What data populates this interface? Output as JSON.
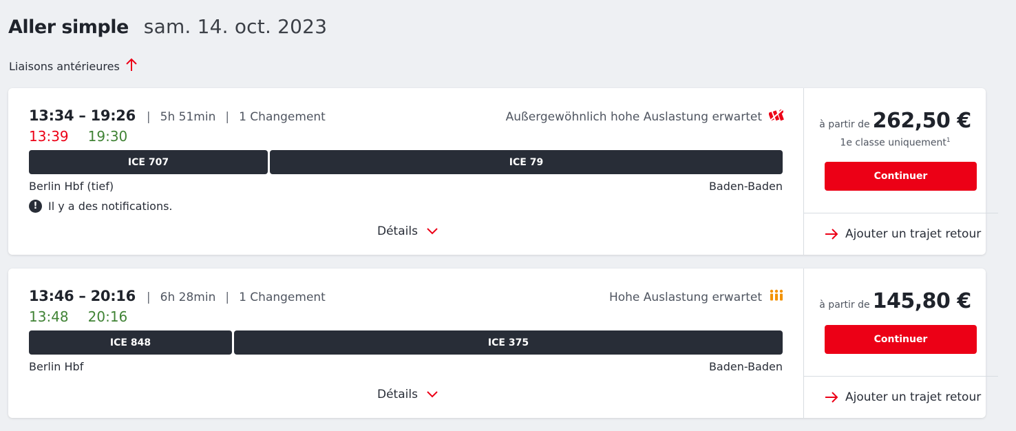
{
  "header": {
    "title": "Aller simple",
    "date": "sam. 14. oct. 2023"
  },
  "earlier_label": "Liaisons antérieures",
  "colors": {
    "accent": "#ec0016",
    "late": "#ec0016",
    "ontime": "#408335",
    "bar": "#282d37",
    "load_high": "#f39200"
  },
  "connections": [
    {
      "times": "13:34 – 19:26",
      "duration": "5h 51min",
      "changes": "1 Changement",
      "rt_dep": "13:39",
      "rt_arr": "19:30",
      "load_text": "Außergewöhnlich hohe Auslastung erwartet",
      "load_icon": "exceptional-load-icon",
      "legs": [
        "ICE 707",
        "ICE 79"
      ],
      "from": "Berlin Hbf (tief)",
      "to": "Baden-Baden",
      "notification": "Il y a des notifications.",
      "details_label": "Détails",
      "price_from": "à partir de",
      "price": "262,50 €",
      "class_note": "1e classe uniquement",
      "class_note_sup": "1",
      "continue_label": "Continuer",
      "return_label": "Ajouter un trajet retour"
    },
    {
      "times": "13:46 – 20:16",
      "duration": "6h 28min",
      "changes": "1 Changement",
      "rt_dep": "13:48",
      "rt_arr": "20:16",
      "load_text": "Hohe Auslastung erwartet",
      "load_icon": "high-load-icon",
      "legs": [
        "ICE 848",
        "ICE 375"
      ],
      "from": "Berlin Hbf",
      "to": "Baden-Baden",
      "details_label": "Détails",
      "price_from": "à partir de",
      "price": "145,80 €",
      "continue_label": "Continuer",
      "return_label": "Ajouter un trajet retour"
    }
  ]
}
